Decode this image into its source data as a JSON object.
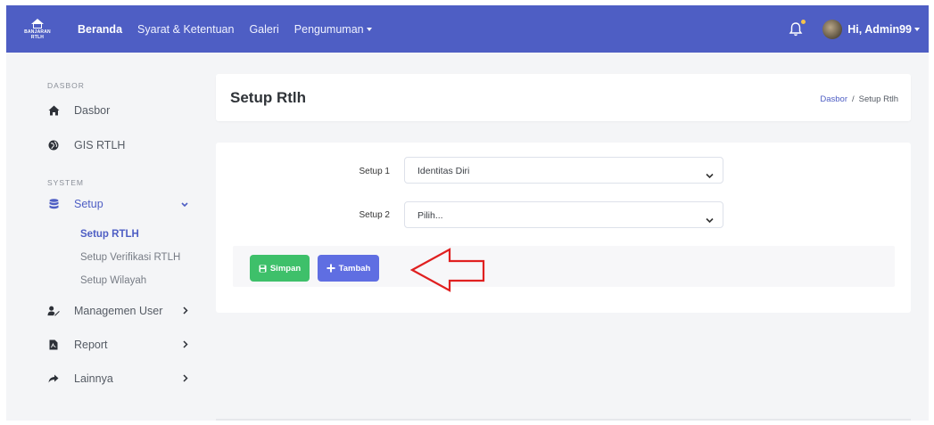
{
  "navbar": {
    "brand_text_1": "BANJARAN",
    "brand_text_2": "RTLH",
    "links": [
      "Beranda",
      "Syarat & Ketentuan",
      "Galeri",
      "Pengumuman"
    ],
    "user_greeting": "Hi, Admin99",
    "color": "#4e5ec4"
  },
  "sidebar": {
    "heading_dasbor": "DASBOR",
    "dasbor": "Dasbor",
    "gis": "GIS RTLH",
    "heading_system": "SYSTEM",
    "setup": "Setup",
    "setup_sub": [
      "Setup RTLH",
      "Setup Verifikasi RTLH",
      "Setup Wilayah"
    ],
    "managemen_user": "Managemen User",
    "report": "Report",
    "lainnya": "Lainnya"
  },
  "page": {
    "title": "Setup Rtlh",
    "breadcrumb_link": "Dasbor",
    "breadcrumb_sep": "/",
    "breadcrumb_current": "Setup Rtlh"
  },
  "form": {
    "setup1_label": "Setup 1",
    "setup1_value": "Identitas Diri",
    "setup2_label": "Setup 2",
    "setup2_value": "Pilih...",
    "save_label": "Simpan",
    "add_label": "Tambah"
  },
  "colors": {
    "accent": "#4e5ec4",
    "save": "#3ec06a",
    "add": "#5f6ee2",
    "annotation": "#e02020"
  }
}
